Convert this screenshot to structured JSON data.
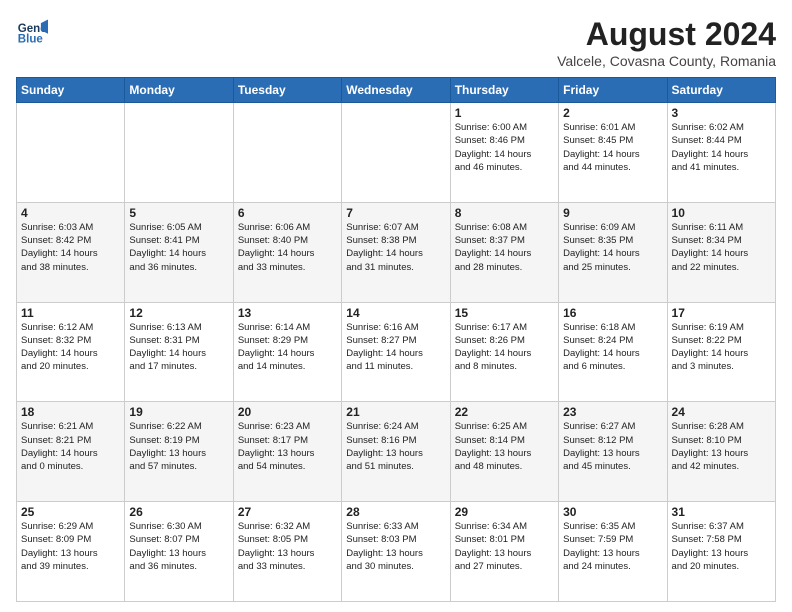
{
  "logo": {
    "line1": "General",
    "line2": "Blue"
  },
  "header": {
    "title": "August 2024",
    "subtitle": "Valcele, Covasna County, Romania"
  },
  "weekdays": [
    "Sunday",
    "Monday",
    "Tuesday",
    "Wednesday",
    "Thursday",
    "Friday",
    "Saturday"
  ],
  "weeks": [
    [
      {
        "day": "",
        "info": ""
      },
      {
        "day": "",
        "info": ""
      },
      {
        "day": "",
        "info": ""
      },
      {
        "day": "",
        "info": ""
      },
      {
        "day": "1",
        "info": "Sunrise: 6:00 AM\nSunset: 8:46 PM\nDaylight: 14 hours\nand 46 minutes."
      },
      {
        "day": "2",
        "info": "Sunrise: 6:01 AM\nSunset: 8:45 PM\nDaylight: 14 hours\nand 44 minutes."
      },
      {
        "day": "3",
        "info": "Sunrise: 6:02 AM\nSunset: 8:44 PM\nDaylight: 14 hours\nand 41 minutes."
      }
    ],
    [
      {
        "day": "4",
        "info": "Sunrise: 6:03 AM\nSunset: 8:42 PM\nDaylight: 14 hours\nand 38 minutes."
      },
      {
        "day": "5",
        "info": "Sunrise: 6:05 AM\nSunset: 8:41 PM\nDaylight: 14 hours\nand 36 minutes."
      },
      {
        "day": "6",
        "info": "Sunrise: 6:06 AM\nSunset: 8:40 PM\nDaylight: 14 hours\nand 33 minutes."
      },
      {
        "day": "7",
        "info": "Sunrise: 6:07 AM\nSunset: 8:38 PM\nDaylight: 14 hours\nand 31 minutes."
      },
      {
        "day": "8",
        "info": "Sunrise: 6:08 AM\nSunset: 8:37 PM\nDaylight: 14 hours\nand 28 minutes."
      },
      {
        "day": "9",
        "info": "Sunrise: 6:09 AM\nSunset: 8:35 PM\nDaylight: 14 hours\nand 25 minutes."
      },
      {
        "day": "10",
        "info": "Sunrise: 6:11 AM\nSunset: 8:34 PM\nDaylight: 14 hours\nand 22 minutes."
      }
    ],
    [
      {
        "day": "11",
        "info": "Sunrise: 6:12 AM\nSunset: 8:32 PM\nDaylight: 14 hours\nand 20 minutes."
      },
      {
        "day": "12",
        "info": "Sunrise: 6:13 AM\nSunset: 8:31 PM\nDaylight: 14 hours\nand 17 minutes."
      },
      {
        "day": "13",
        "info": "Sunrise: 6:14 AM\nSunset: 8:29 PM\nDaylight: 14 hours\nand 14 minutes."
      },
      {
        "day": "14",
        "info": "Sunrise: 6:16 AM\nSunset: 8:27 PM\nDaylight: 14 hours\nand 11 minutes."
      },
      {
        "day": "15",
        "info": "Sunrise: 6:17 AM\nSunset: 8:26 PM\nDaylight: 14 hours\nand 8 minutes."
      },
      {
        "day": "16",
        "info": "Sunrise: 6:18 AM\nSunset: 8:24 PM\nDaylight: 14 hours\nand 6 minutes."
      },
      {
        "day": "17",
        "info": "Sunrise: 6:19 AM\nSunset: 8:22 PM\nDaylight: 14 hours\nand 3 minutes."
      }
    ],
    [
      {
        "day": "18",
        "info": "Sunrise: 6:21 AM\nSunset: 8:21 PM\nDaylight: 14 hours\nand 0 minutes."
      },
      {
        "day": "19",
        "info": "Sunrise: 6:22 AM\nSunset: 8:19 PM\nDaylight: 13 hours\nand 57 minutes."
      },
      {
        "day": "20",
        "info": "Sunrise: 6:23 AM\nSunset: 8:17 PM\nDaylight: 13 hours\nand 54 minutes."
      },
      {
        "day": "21",
        "info": "Sunrise: 6:24 AM\nSunset: 8:16 PM\nDaylight: 13 hours\nand 51 minutes."
      },
      {
        "day": "22",
        "info": "Sunrise: 6:25 AM\nSunset: 8:14 PM\nDaylight: 13 hours\nand 48 minutes."
      },
      {
        "day": "23",
        "info": "Sunrise: 6:27 AM\nSunset: 8:12 PM\nDaylight: 13 hours\nand 45 minutes."
      },
      {
        "day": "24",
        "info": "Sunrise: 6:28 AM\nSunset: 8:10 PM\nDaylight: 13 hours\nand 42 minutes."
      }
    ],
    [
      {
        "day": "25",
        "info": "Sunrise: 6:29 AM\nSunset: 8:09 PM\nDaylight: 13 hours\nand 39 minutes."
      },
      {
        "day": "26",
        "info": "Sunrise: 6:30 AM\nSunset: 8:07 PM\nDaylight: 13 hours\nand 36 minutes."
      },
      {
        "day": "27",
        "info": "Sunrise: 6:32 AM\nSunset: 8:05 PM\nDaylight: 13 hours\nand 33 minutes."
      },
      {
        "day": "28",
        "info": "Sunrise: 6:33 AM\nSunset: 8:03 PM\nDaylight: 13 hours\nand 30 minutes."
      },
      {
        "day": "29",
        "info": "Sunrise: 6:34 AM\nSunset: 8:01 PM\nDaylight: 13 hours\nand 27 minutes."
      },
      {
        "day": "30",
        "info": "Sunrise: 6:35 AM\nSunset: 7:59 PM\nDaylight: 13 hours\nand 24 minutes."
      },
      {
        "day": "31",
        "info": "Sunrise: 6:37 AM\nSunset: 7:58 PM\nDaylight: 13 hours\nand 20 minutes."
      }
    ]
  ]
}
